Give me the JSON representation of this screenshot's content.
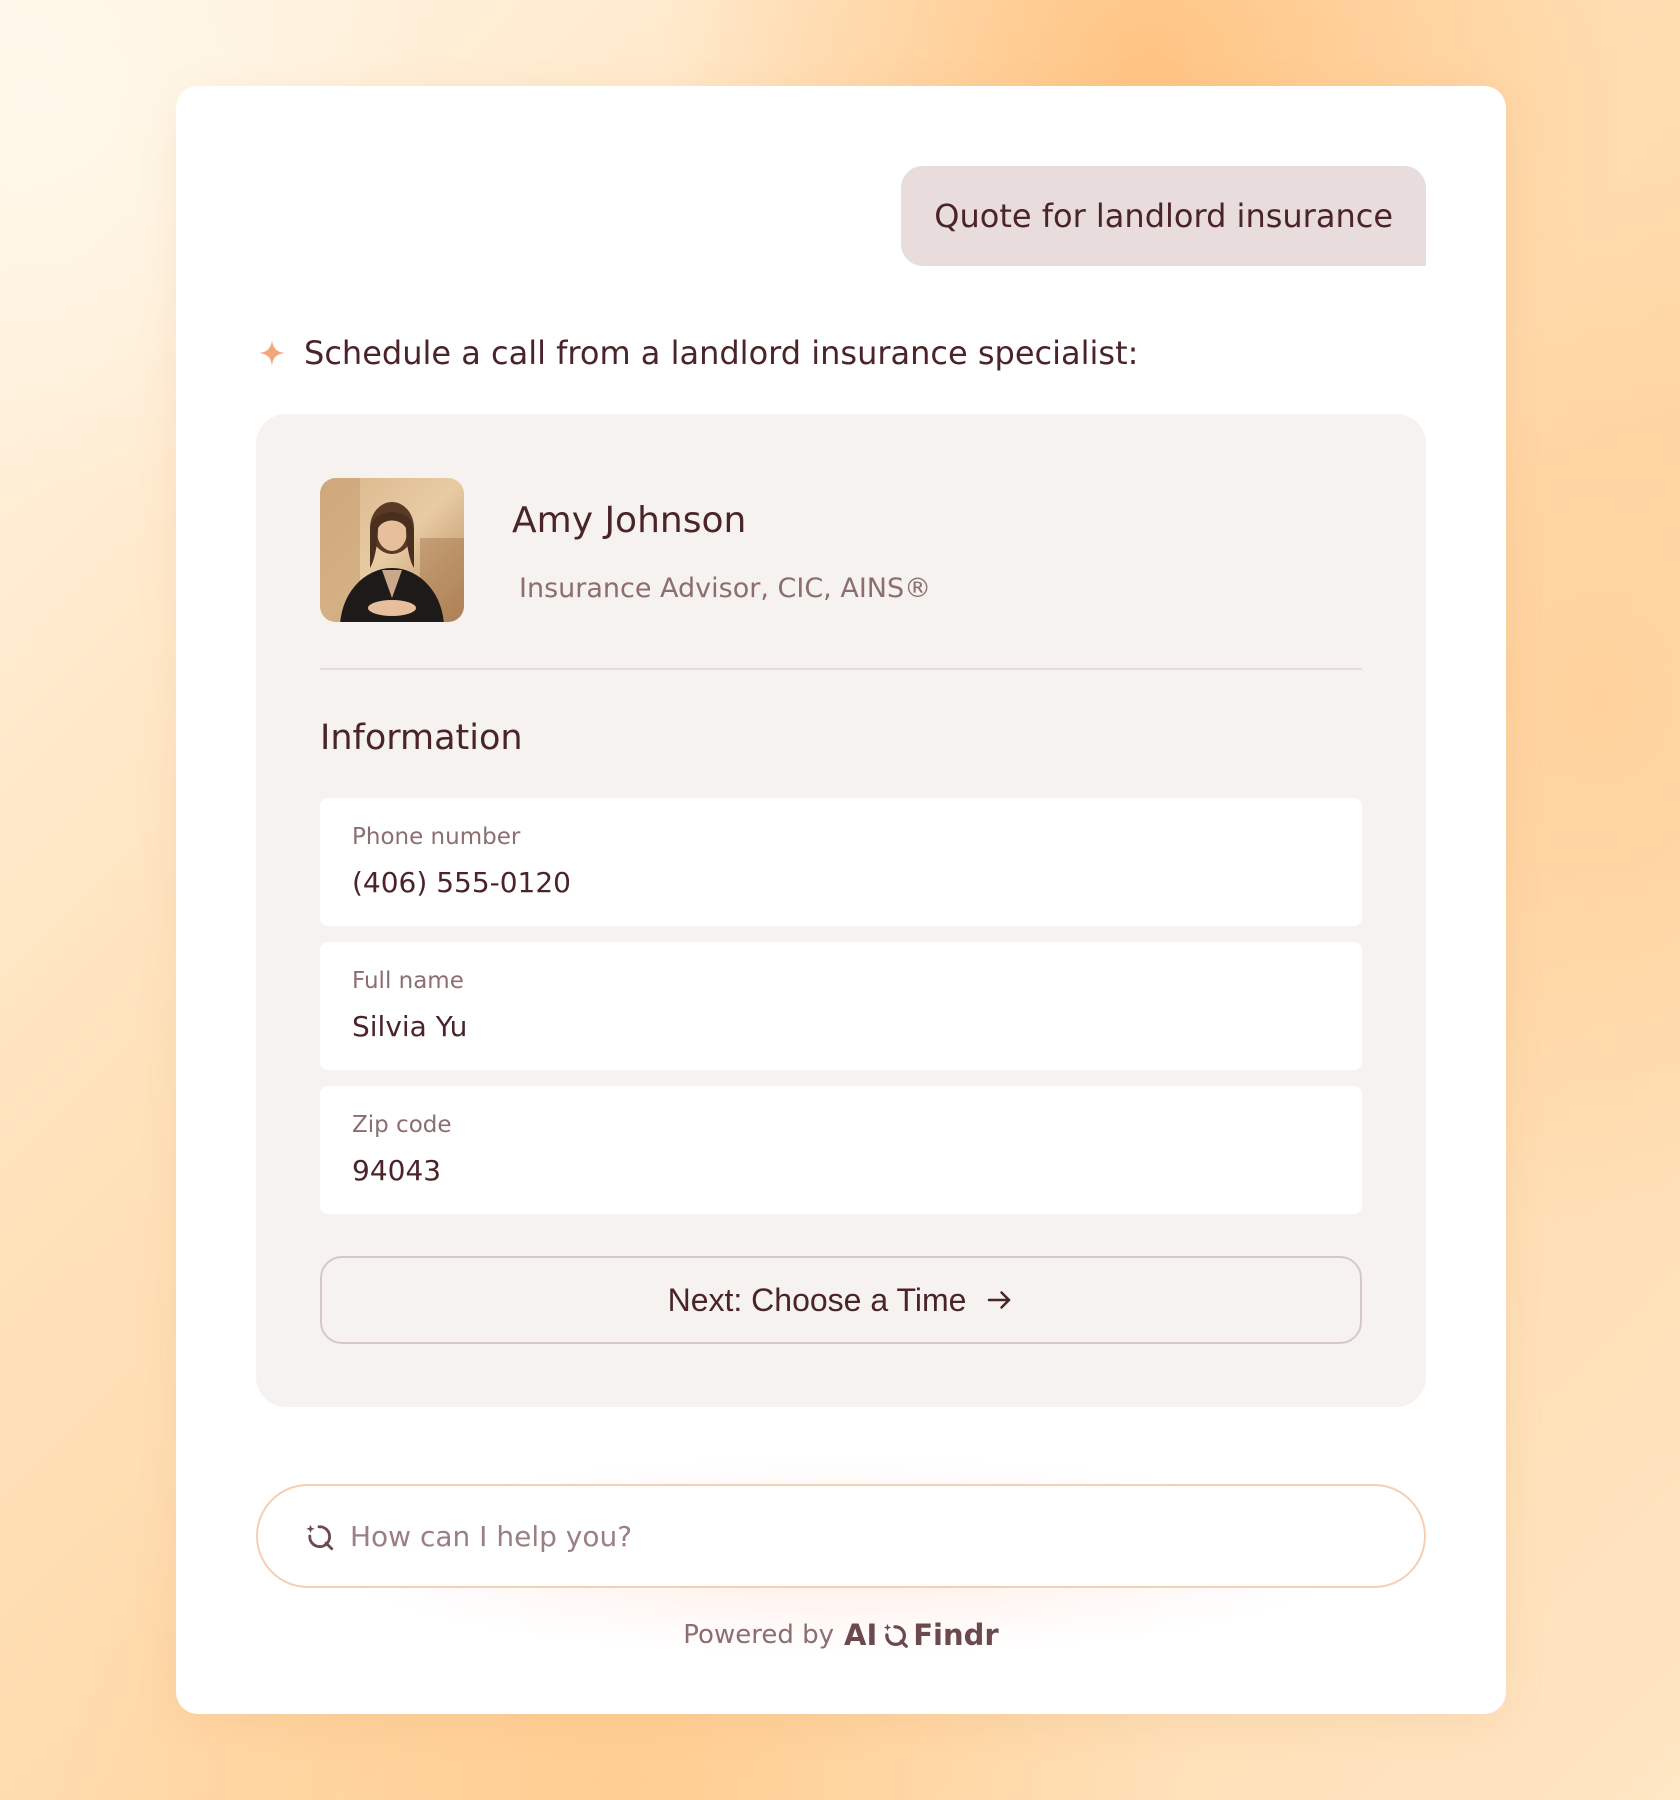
{
  "chat": {
    "user_message": "Quote for landlord insurance",
    "assistant_message": "Schedule a call from a landlord insurance specialist:"
  },
  "advisor": {
    "name": "Amy Johnson",
    "title": "Insurance Advisor, CIC, AINS®"
  },
  "form": {
    "section_title": "Information",
    "fields": [
      {
        "label": "Phone number",
        "value": "(406) 555-0120"
      },
      {
        "label": "Full name",
        "value": "Silvia Yu"
      },
      {
        "label": "Zip code",
        "value": "94043"
      }
    ],
    "next_button_label": "Next: Choose a Time"
  },
  "input": {
    "placeholder": "How can I help you?"
  },
  "footer": {
    "powered_by": "Powered by",
    "brand_ai": "AI",
    "brand_findr": "Findr"
  },
  "colors": {
    "accent_sparkle": "#f4a57a",
    "text_primary": "#4a2428",
    "text_secondary": "#8d6e70",
    "user_bubble": "#e8dcdc",
    "card_bg": "#f5f2ef",
    "input_border": "#f6cfb3"
  },
  "icons": {
    "sparkle": "sparkle-icon",
    "next_arrow": "arrow-right-icon",
    "input": "ai-search-icon",
    "brand": "ai-search-icon"
  }
}
